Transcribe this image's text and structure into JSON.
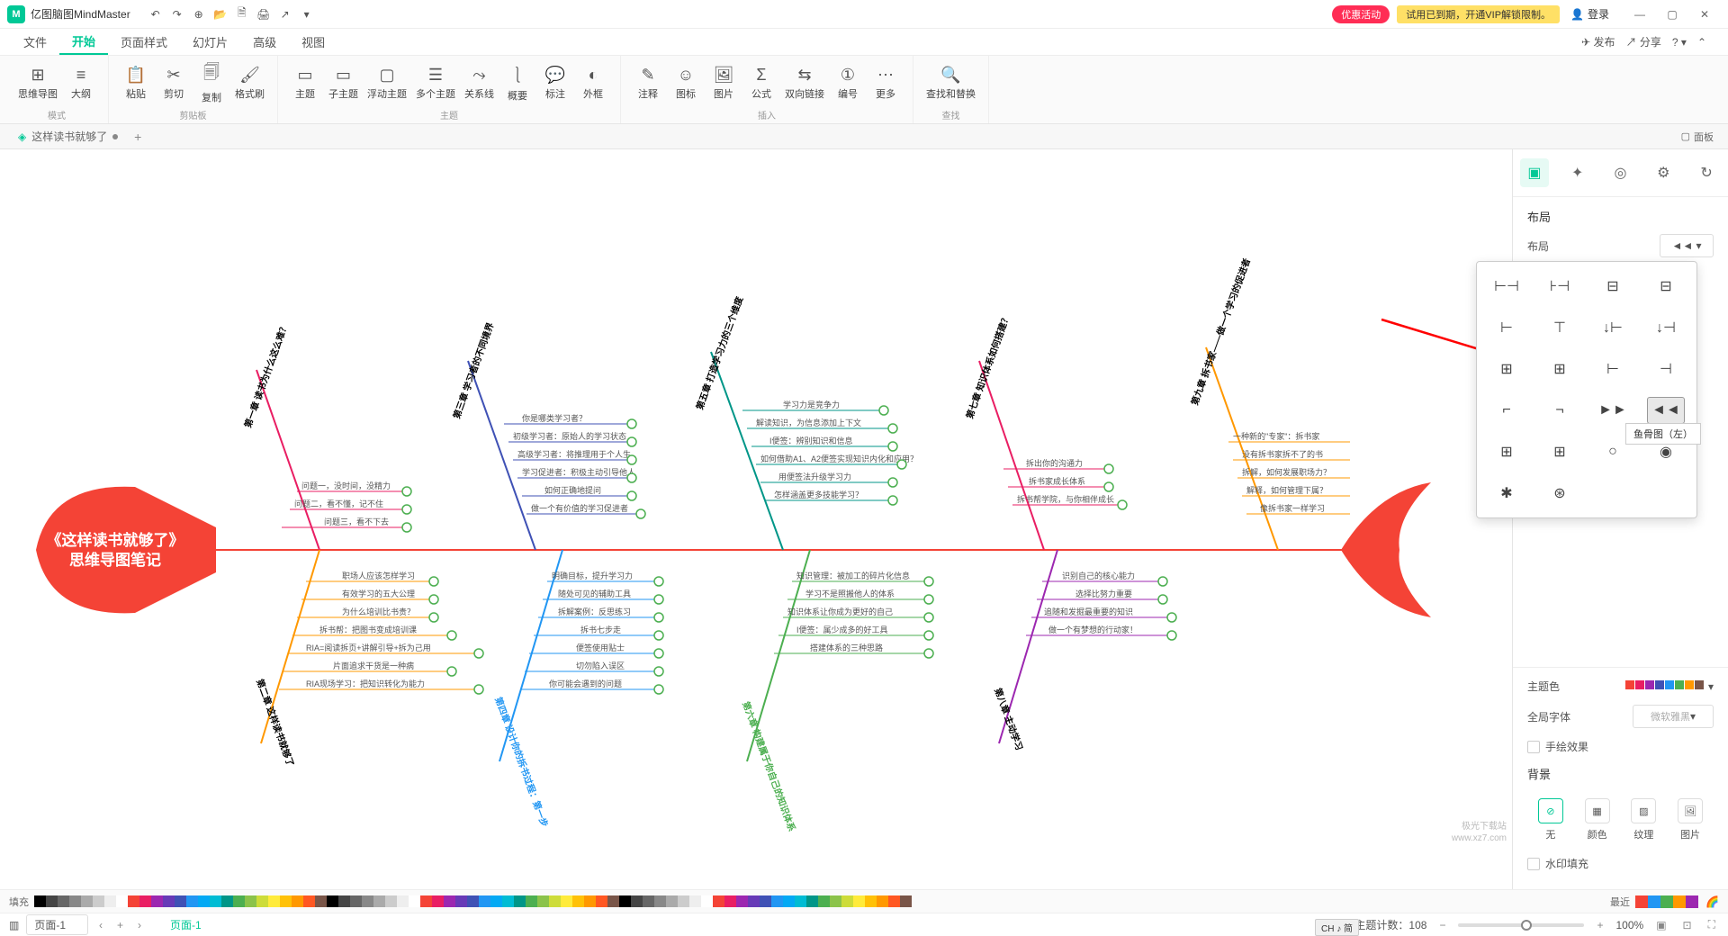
{
  "app": {
    "name": "亿图脑图MindMaster"
  },
  "qat": [
    "↶",
    "→",
    "⊕",
    "📁",
    "🖨",
    "📄",
    "↗"
  ],
  "promoBadge": "优惠活动",
  "trialBadge": "试用已到期，开通VIP解锁限制。",
  "loginLabel": "登录",
  "menuTabs": [
    "文件",
    "开始",
    "页面样式",
    "幻灯片",
    "高级",
    "视图"
  ],
  "menuActions": {
    "publish": "发布",
    "share": "分享"
  },
  "ribbon": {
    "groups": [
      {
        "label": "模式",
        "tools": [
          {
            "icon": "⊞",
            "label": "思维导图"
          },
          {
            "icon": "≡",
            "label": "大纲"
          }
        ]
      },
      {
        "label": "剪贴板",
        "tools": [
          {
            "icon": "📋",
            "label": "粘贴"
          },
          {
            "icon": "✂",
            "label": "剪切"
          },
          {
            "icon": "📋",
            "label": "复制"
          },
          {
            "icon": "🖌",
            "label": "格式刷"
          }
        ]
      },
      {
        "label": "主题",
        "tools": [
          {
            "icon": "▢",
            "label": "主题"
          },
          {
            "icon": "▢",
            "label": "子主题"
          },
          {
            "icon": "▢",
            "label": "浮动主题"
          },
          {
            "icon": "▢",
            "label": "多个主题"
          },
          {
            "icon": "✕",
            "label": "关系线"
          },
          {
            "icon": "▢",
            "label": "概要"
          },
          {
            "icon": "⟳",
            "label": "标注"
          },
          {
            "icon": "◐",
            "label": "外框"
          }
        ]
      },
      {
        "label": "插入",
        "tools": [
          {
            "icon": "✎",
            "label": "注释"
          },
          {
            "icon": "⊙",
            "label": "图标"
          },
          {
            "icon": "🖼",
            "label": "图片"
          },
          {
            "icon": "Σ",
            "label": "公式"
          },
          {
            "icon": "⇆",
            "label": "双向链接"
          },
          {
            "icon": "#",
            "label": "编号"
          },
          {
            "icon": "⋯",
            "label": "更多"
          }
        ]
      },
      {
        "label": "查找",
        "tools": [
          {
            "icon": "🔍",
            "label": "查找和替换"
          }
        ]
      }
    ]
  },
  "docTab": {
    "name": "这样读书就够了"
  },
  "panelToggle": "面板",
  "rightPanel": {
    "sectionLayout": "布局",
    "layoutLabel": "布局",
    "themeColor": "主题色",
    "globalFont": "全局字体",
    "fontValue": "微软雅黑",
    "handdrawn": "手绘效果",
    "background": "背景",
    "bgOptions": [
      {
        "label": "无"
      },
      {
        "label": "颜色"
      },
      {
        "label": "纹理"
      },
      {
        "label": "图片"
      }
    ],
    "watermarkFill": "水印填充"
  },
  "layoutTooltip": "鱼骨图（左）",
  "colorbarLabel": "填充",
  "recentLabel": "最近",
  "imeLabel": "CH ♪ 简",
  "statusbar": {
    "page": "页面-1",
    "pageTab": "页面-1",
    "topicCount": "主题计数：108",
    "zoom": "100%"
  },
  "watermark": {
    "l1": "极光下载站",
    "l2": "www.xz7.com"
  },
  "mindmap": {
    "title1": "《这样读书就够了》",
    "title2": "思维导图笔记",
    "branches": {
      "c1": {
        "label": "第一章 读书为什么这么难？",
        "items": [
          "问题一，没时间，没精力",
          "问题二，看不懂，记不住",
          "问题三，看不下去"
        ]
      },
      "c2": {
        "label": "第二章 这样读书就够了",
        "items": [
          "职场人应该怎样学习",
          "有效学习的五大公理",
          "为什么培训比书贵？",
          "拆书帮：把图书变成培训课",
          "RIA=阅读拆页+讲解引导+拆为己用",
          "片面追求干货是一种病",
          "RIA现场学习：把知识转化为能力"
        ]
      },
      "c3": {
        "label": "第三章 学习者的不同境界",
        "items": [
          "你是哪类学习者？",
          "初级学习者：原始人的学习状态",
          "高级学习者：将推理用于个人生",
          "学习促进者：积极主动引导他人",
          "如何正确地提问",
          "做一个有价值的学习促进者"
        ]
      },
      "c4": {
        "label": "第四章 设计你的拆书过程：第一步",
        "items": [
          "明确目标，提升学习力",
          "随处可见的辅助工具",
          "拆解案例：反思练习",
          "拆书七步走",
          "便签使用贴士",
          "切勿陷入误区",
          "你可能会遇到的问题"
        ]
      },
      "c5": {
        "label": "第五章 打造学习力的三个维度",
        "items": [
          "学习力是竞争力",
          "解读知识，为信息添加上下文",
          "I便签：辨别知识和信息",
          "如何借助A1、A2便签实现知识内化和应用？",
          "用便签法升级学习力",
          "怎样涵盖更多技能学习？"
        ]
      },
      "c6": {
        "label": "第六章 构建属于你自己的知识体系",
        "items": [
          "知识管理：被加工的碎片化信息",
          "学习不是照搬他人的体系",
          "知识体系让你成为更好的自己",
          "I便签：属少成多的好工具",
          "搭建体系的三种思路"
        ]
      },
      "c7": {
        "label": "第七章 知识体系如何搭建？",
        "items": [
          "拆出你的沟通力",
          "拆书家成长体系",
          "拆书帮学院，与你相伴成长"
        ]
      },
      "c8": {
        "label": "第八章 主动学习",
        "items": [
          "识别自己的核心能力",
          "选择比努力重要",
          "追随和发掘最重要的知识",
          "做一个有梦想的行动家！"
        ]
      },
      "c9": {
        "label": "第九章 拆书家——做一个学习的促进者",
        "items": [
          "一种新的\"专家\"：拆书家",
          "没有拆书家拆不了的书",
          "拆解，如何发展职场力？",
          "解释，如何管理下属？",
          "像拆书家一样学习"
        ]
      }
    }
  }
}
